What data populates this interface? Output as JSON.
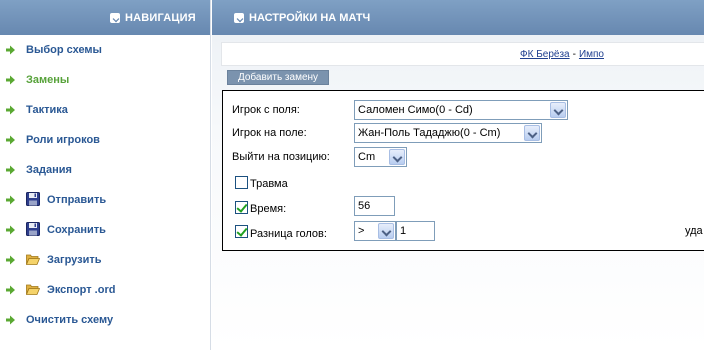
{
  "nav": {
    "title": "НАВИГАЦИЯ",
    "items": [
      {
        "label": "Выбор схемы",
        "icon": "arrow-right-icon"
      },
      {
        "label": "Замены",
        "icon": "arrow-right-icon",
        "active": true
      },
      {
        "label": "Тактика",
        "icon": "arrow-right-icon"
      },
      {
        "label": "Роли игроков",
        "icon": "arrow-right-icon"
      },
      {
        "label": "Задания",
        "icon": "arrow-right-icon"
      },
      {
        "label": "Отправить",
        "icon": "floppy-disk-icon"
      },
      {
        "label": "Сохранить",
        "icon": "floppy-disk-icon"
      },
      {
        "label": "Загрузить",
        "icon": "open-folder-icon"
      },
      {
        "label": "Экспорт .ord",
        "icon": "open-folder-icon"
      },
      {
        "label": "Очистить схему",
        "icon": "arrow-right-icon"
      }
    ]
  },
  "main": {
    "title": "НАСТРОЙКИ НА МАТЧ",
    "match": {
      "home": "ФК Берёза",
      "separator": "-",
      "away": "Импо"
    },
    "add_button": "Добавить замену",
    "form": {
      "player_out_label": "Игрок с поля:",
      "player_out_value": "Саломен Симо(0 - Cd)",
      "player_in_label": "Игрок на поле:",
      "player_in_value": "Жан-Поль Тададжю(0 - Cm)",
      "position_label": "Выйти на позицию:",
      "position_value": "Cm",
      "injury_label": "Травма",
      "injury_checked": false,
      "time_label": "Время:",
      "time_checked": true,
      "time_value": "56",
      "goal_diff_label": "Разница голов:",
      "goal_diff_checked": true,
      "goal_diff_operator": ">",
      "goal_diff_value": "1",
      "edge_text": "уда"
    }
  },
  "colors": {
    "header_bg": "#7393ba",
    "nav_link": "#2a5894",
    "nav_active": "#57a23a",
    "arrow": "#5aa832"
  }
}
